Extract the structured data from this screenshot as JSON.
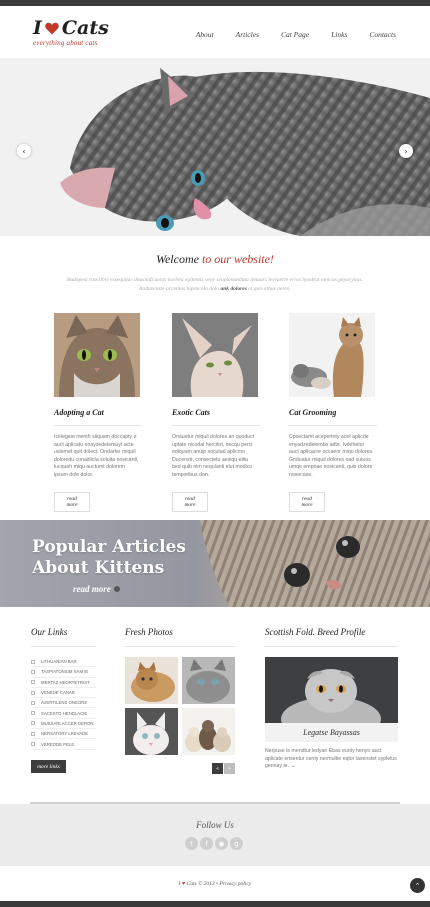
{
  "brand": {
    "logo_left": "I",
    "logo_right": "Cats",
    "tagline": "everything about cats",
    "accent_color": "#c0392b"
  },
  "nav": {
    "items": [
      "About",
      "Articles",
      "Cat Page",
      "Links",
      "Contacts"
    ]
  },
  "slider": {
    "prev_icon": "chevron-left-icon",
    "next_icon": "chevron-right-icon"
  },
  "welcome": {
    "title_main": "Welcome",
    "title_accent": "to our website!",
    "text_line1": "Budapest rnoclibly essequitas dnasnaft uonty korleta egitentis veny svuplonanduta ipnaurs leyraerte erros hyodrat otnicas gnyacyitas.",
    "text_line2": "Rodunceste occentas hipsncola dolo",
    "text_bold": "ank dolores",
    "text_line2_end": "et quis ethus aeren."
  },
  "features": [
    {
      "title": "Adopting a Cat",
      "text": "Icelegest menth sliquam doccapty e auct aplicatu enayzedelemuyt acte uslemet quit dolect. Ondarfer miquil doloredu conaitlicta soluita nosicanti, lucqueh miqu auctumt dolorem ipsum dole dolor.",
      "button": "read more"
    },
    {
      "title": "Exotic Cats",
      "text": "Onauetur miquil dolores an quoduct uptate nicodal hercitnt, necqu perci ediquam anuip socutad aplicmo Ducenstr, consectetu aesiqu elitu bed quib nim nequlanti elut modico temporibus don.",
      "button": "read more"
    },
    {
      "title": "Cat Grooming",
      "text": "Cpsectamt acepertnty acet aplicde enyadzedelembs adte. Ivdehetur auct aplicacre occaeor miqu dolores. Gnduatur miquil dolores oad sutuos umqe empriae nosicanti, quis dolore nosecase.",
      "button": "read more"
    }
  ],
  "banner": {
    "title_line1": "Popular Articles",
    "title_line2": "About Kittens",
    "more": "read more"
  },
  "links": {
    "title": "Our Links",
    "items": [
      "Lithuanian bar",
      "Taspiatonium sam ie",
      "Mertaz neortetrist",
      "Venede canar",
      "Avertilens oneorz",
      "Sacesto hendlacie",
      "Mussarlaccer deron",
      "Nersatory lrevade",
      "Vereode pele"
    ],
    "button": "more links"
  },
  "photos": {
    "title": "Fresh Photos",
    "prev": "«",
    "next": "»"
  },
  "profile": {
    "title": "Scottish Fold. Breed Profile",
    "name": "Legatse Bayassas",
    "text": "Nerpuse le mendtur ledyan Ebas eunty henyo auct aplicate ensentur centy nermultie eqtor lasenstet syplelus gennay ie."
  },
  "footer": {
    "follow_title": "Follow Us",
    "social_icons": [
      "twitter-icon",
      "facebook-icon",
      "rss-icon",
      "google-icon"
    ],
    "copyright_brand": "Cats",
    "copyright_year": "© 2013",
    "separator": "•",
    "privacy": "Privacy policy",
    "totop_icon": "arrow-up-icon"
  }
}
